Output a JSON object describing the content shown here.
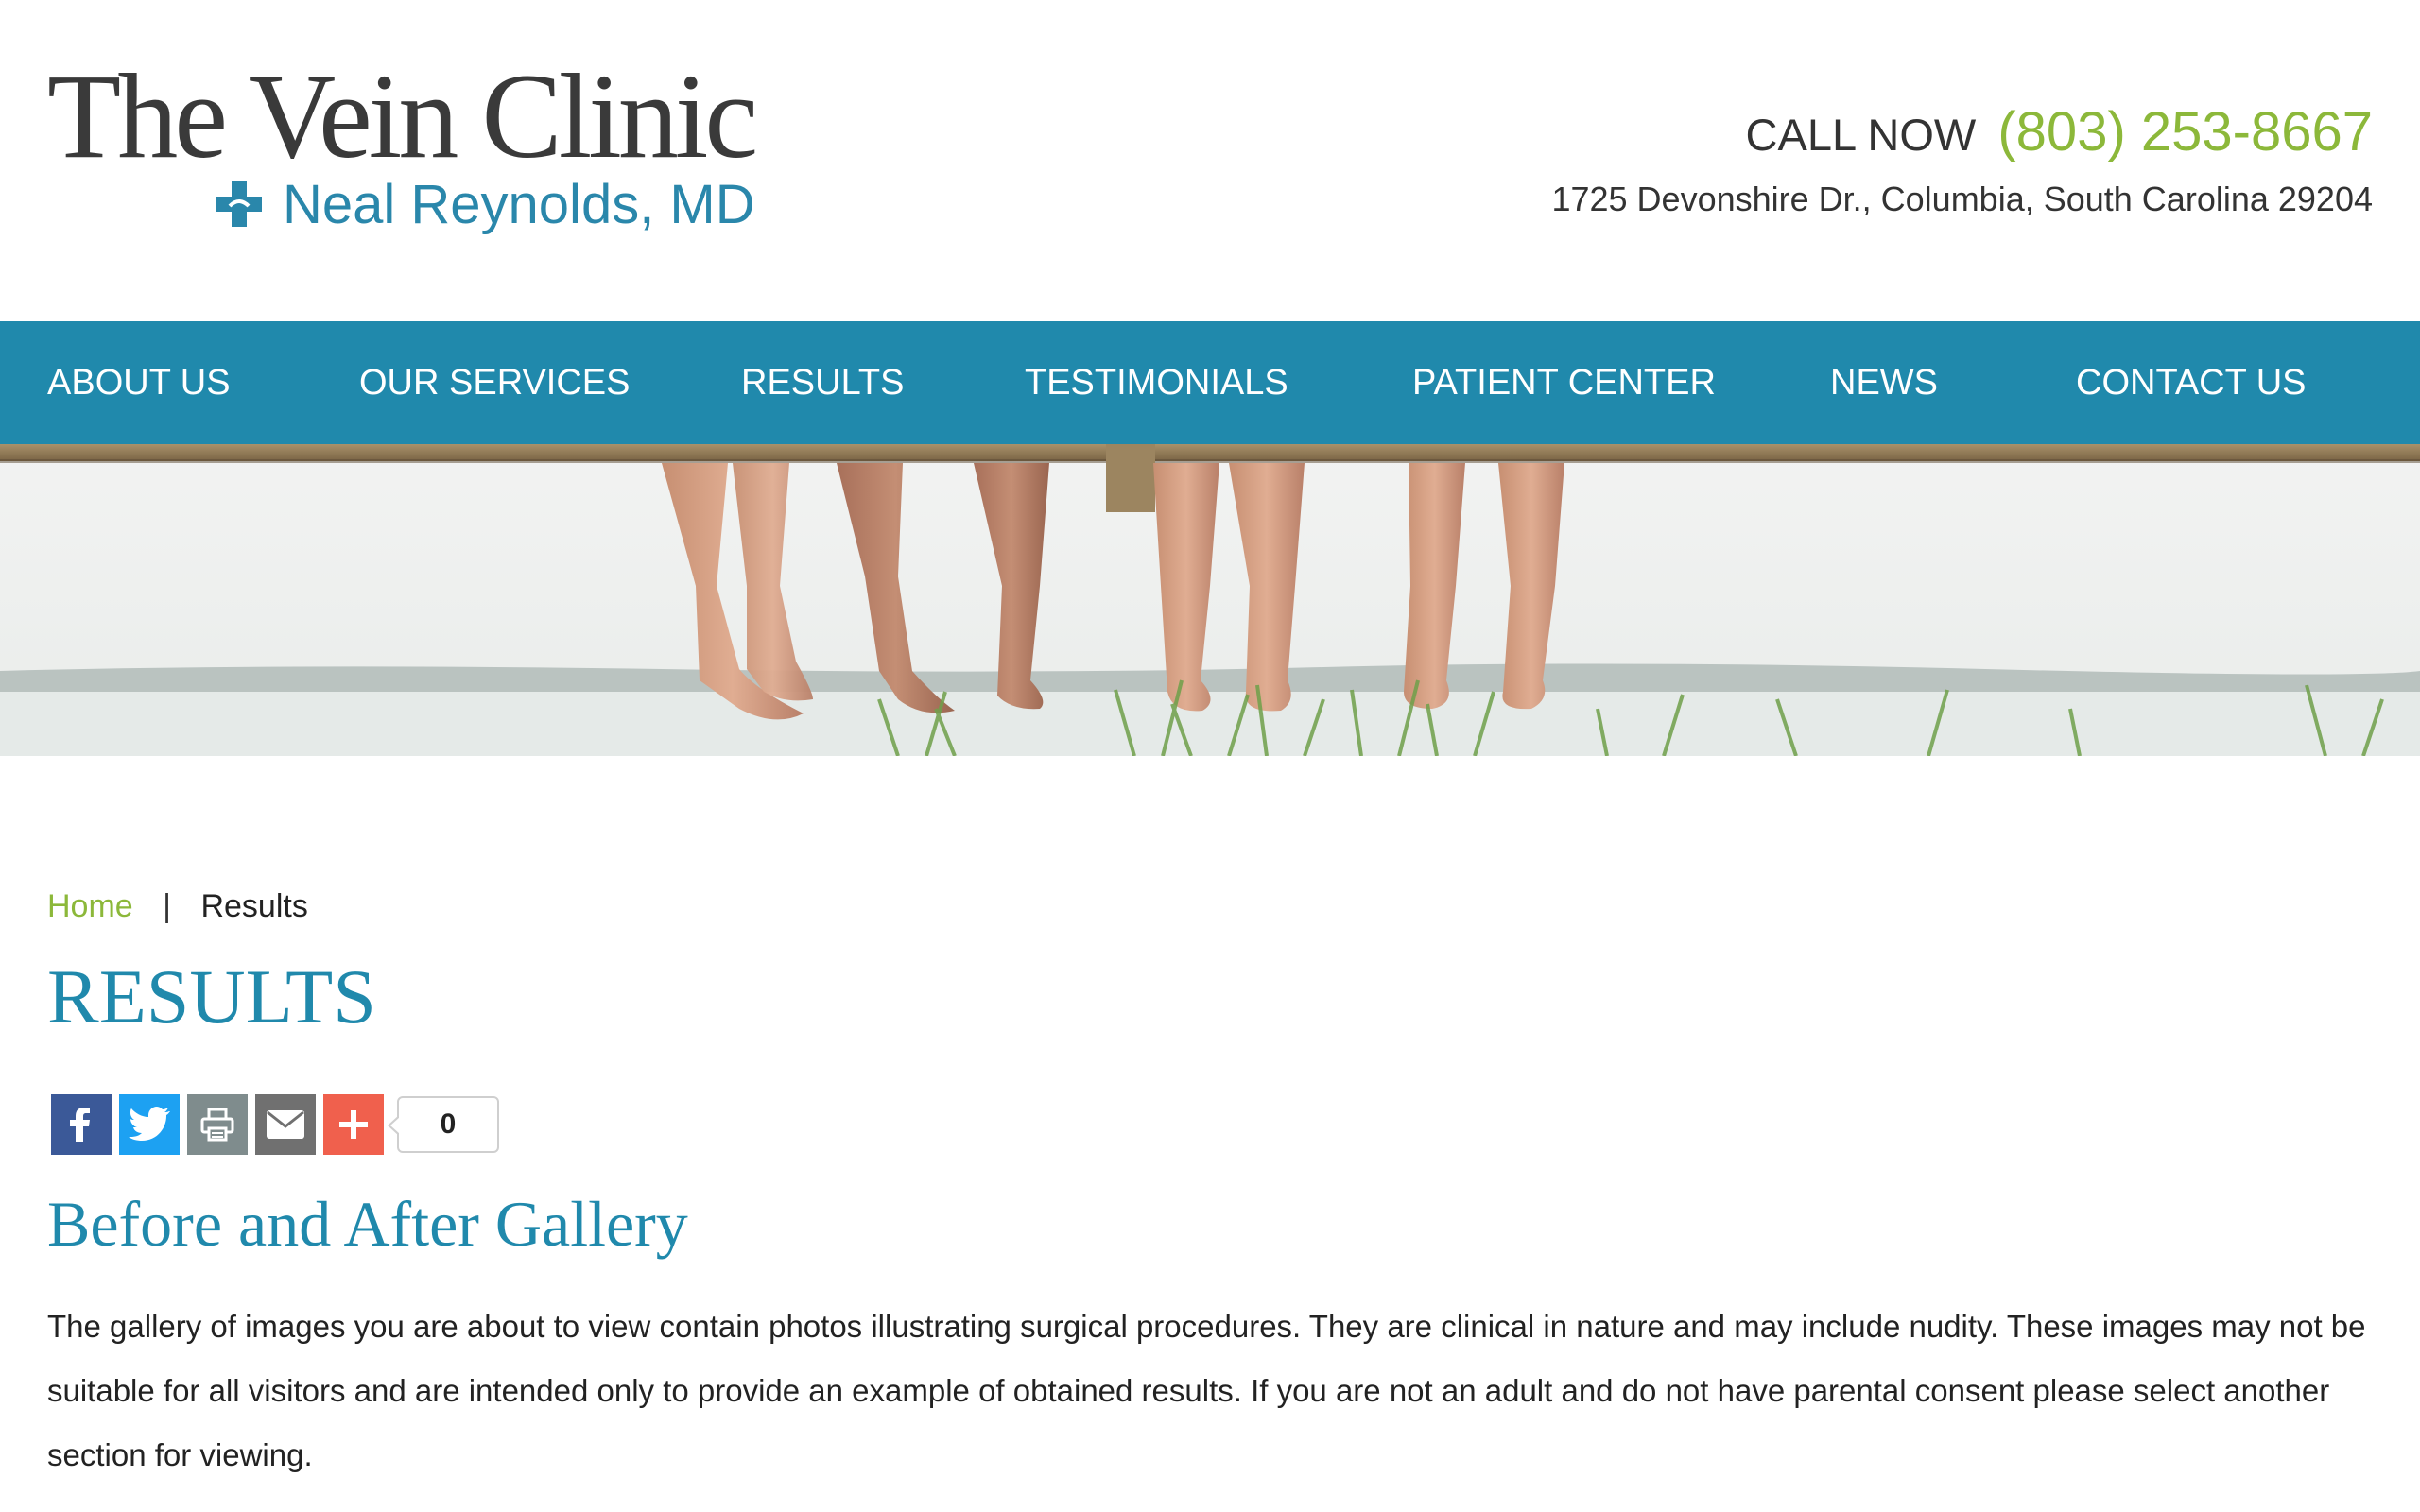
{
  "header": {
    "logo_title": "The Vein Clinic",
    "logo_subtitle": "Neal Reynolds, MD",
    "call_label": "CALL NOW",
    "phone": "(803) 253-8667",
    "address": "1725 Devonshire Dr., Columbia, South Carolina 29204"
  },
  "nav": {
    "items": [
      {
        "label": "ABOUT US"
      },
      {
        "label": "OUR SERVICES"
      },
      {
        "label": "RESULTS"
      },
      {
        "label": "TESTIMONIALS"
      },
      {
        "label": "PATIENT CENTER"
      },
      {
        "label": "NEWS"
      },
      {
        "label": "CONTACT US"
      }
    ]
  },
  "breadcrumb": {
    "home": "Home",
    "separator": "|",
    "current": "Results"
  },
  "page": {
    "title": "RESULTS",
    "share_count": "0",
    "section_heading": "Before and After Gallery",
    "body": "The gallery of images you are about to view contain photos illustrating surgical procedures. They are clinical in nature and may include nudity. These images may not be suitable for all visitors and are intended only to provide an example of obtained results. If you are not an adult and do not have parental consent please select another section for viewing."
  },
  "colors": {
    "brand_blue": "#2089ac",
    "accent_green": "#8cb83a",
    "facebook": "#3b5998",
    "twitter": "#1da1f2",
    "print": "#7f8c8d",
    "email": "#707070",
    "more": "#f0604d"
  },
  "icons": [
    "medical-cross-icon",
    "facebook-icon",
    "twitter-icon",
    "print-icon",
    "email-icon",
    "plus-icon"
  ]
}
